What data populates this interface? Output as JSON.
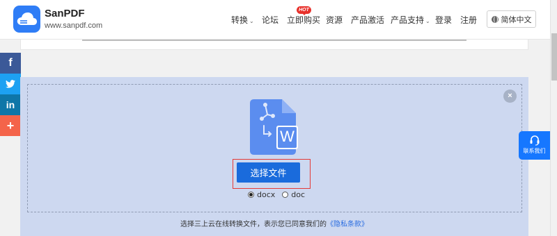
{
  "brand": {
    "name": "SanPDF",
    "url": "www.sanpdf.com",
    "logo_color": "#2f7df6"
  },
  "nav": {
    "items": [
      {
        "label": "转换",
        "dropdown": true
      },
      {
        "label": "论坛",
        "dropdown": false
      },
      {
        "label": "立即购买",
        "dropdown": false,
        "badge": "HOT"
      },
      {
        "label": "资源",
        "dropdown": false
      },
      {
        "label": "产品激活",
        "dropdown": false
      },
      {
        "label": "产品支持",
        "dropdown": true
      },
      {
        "label": "登录",
        "dropdown": false
      },
      {
        "label": "注册",
        "dropdown": false
      }
    ],
    "language": "简体中文"
  },
  "social": [
    {
      "name": "facebook",
      "glyph": "f"
    },
    {
      "name": "twitter",
      "glyph": "twitter-bird-icon"
    },
    {
      "name": "linkedin",
      "glyph": "in"
    },
    {
      "name": "more",
      "glyph": "+"
    }
  ],
  "converter": {
    "icon": "pdf-to-word-icon",
    "word_badge": "W",
    "choose_button": "选择文件",
    "formats": [
      {
        "label": "docx",
        "selected": true
      },
      {
        "label": "doc",
        "selected": false
      }
    ],
    "terms_text": "选择三上云在线转换文件，表示您已同意我们的",
    "terms_link": "《隐私条款》",
    "close_glyph": "×"
  },
  "contact": {
    "label": "联系我们"
  },
  "colors": {
    "accent": "#1a6bdc",
    "zone_bg": "#cdd8f0",
    "hot": "#e8322c",
    "highlight_outline": "#e53935"
  }
}
